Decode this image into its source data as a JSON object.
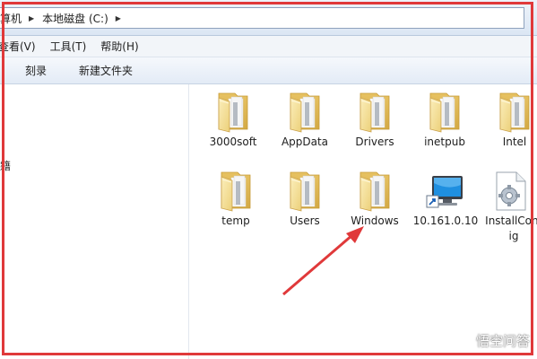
{
  "address": {
    "crumbs": [
      "算机",
      "本地磁盘 (C:)"
    ]
  },
  "menu": {
    "items": [
      "查看(V)",
      "工具(T)",
      "帮助(H)"
    ]
  },
  "toolbar": {
    "burn_label": "刻录",
    "new_folder_label": "新建文件夹"
  },
  "nav": {
    "fragment": "籍"
  },
  "files": [
    {
      "name": "3000soft",
      "icon": "folder-icon"
    },
    {
      "name": "AppData",
      "icon": "folder-icon"
    },
    {
      "name": "Drivers",
      "icon": "folder-icon"
    },
    {
      "name": "inetpub",
      "icon": "folder-icon"
    },
    {
      "name": "Intel",
      "icon": "folder-icon"
    },
    {
      "name": "temp",
      "icon": "folder-icon"
    },
    {
      "name": "Users",
      "icon": "folder-icon"
    },
    {
      "name": "Windows",
      "icon": "folder-icon"
    },
    {
      "name": "10.161.0.10",
      "icon": "computer-shortcut-icon"
    },
    {
      "name": "InstallConfig",
      "icon": "config-file-icon"
    }
  ],
  "watermark": {
    "text": "悟空问答"
  },
  "colors": {
    "annotation": "#e0393a",
    "folder": "#f2d888"
  }
}
